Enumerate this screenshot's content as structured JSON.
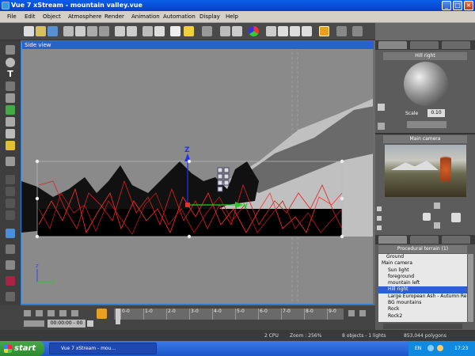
{
  "window": {
    "title": "Vue 7 xStream - mountain valley.vue"
  },
  "menu": [
    "File",
    "Edit",
    "Object",
    "Atmosphere",
    "Render",
    "Animation",
    "Automation",
    "Display",
    "Help"
  ],
  "viewport": {
    "label": "Side view",
    "axis_z": "Z",
    "axis_y": "y",
    "axis_z_small": "z",
    "axis_y_small": "y"
  },
  "material_panel": {
    "header": "Hill right",
    "scale_label": "Scale",
    "scale_value": "0.10"
  },
  "camera_panel": {
    "header": "Main camera"
  },
  "world_browser": {
    "header": "Procedural terrain (1)",
    "items": [
      "Ground",
      "Main camera",
      "Sun light",
      "foreground",
      "mountain left",
      "Hill right",
      "Large European Ash - Autumn Re",
      "BG mountains",
      "Rock",
      "Rock2"
    ],
    "selected_index": 5
  },
  "timeline": {
    "time_value": "00:00:00 - 00",
    "ticks": [
      "0-0",
      "1-0",
      "2-0",
      "3-0",
      "4-0",
      "5-0",
      "6-0",
      "7-0",
      "8-0",
      "9-0"
    ]
  },
  "statusbar": {
    "cpu": "2 CPU",
    "zoom": "Zoom : 256%",
    "objects": "8 objects - 1 lights",
    "polygons": "853,044 polygons"
  },
  "taskbar": {
    "start": "start",
    "task": "Vue 7 xStream - mou...",
    "lang": "EN",
    "clock": "17:23"
  }
}
